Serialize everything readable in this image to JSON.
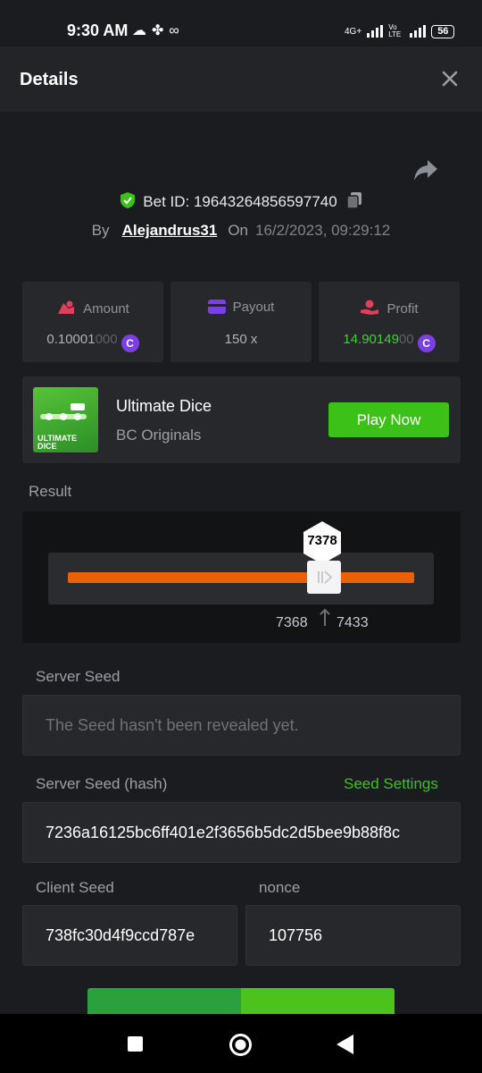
{
  "status_bar": {
    "time": "9:30 AM",
    "left_icons": [
      "cloud-icon",
      "fan-icon",
      "voicemail-icon"
    ],
    "network_label": "4G+",
    "volte_label": "Vo LTE",
    "battery": "56"
  },
  "header": {
    "title": "Details"
  },
  "bet": {
    "id_label": "Bet ID: 19643264856597740",
    "by_label": "By",
    "username": "Alejandrus31",
    "on_label": "On",
    "datetime": "16/2/2023, 09:29:12"
  },
  "stats": {
    "amount": {
      "label": "Amount",
      "value_main": "0.10001",
      "value_dim": "000",
      "coin": "C"
    },
    "payout": {
      "label": "Payout",
      "value": "150 x"
    },
    "profit": {
      "label": "Profit",
      "value_main": "14.90149",
      "value_dim": "00",
      "coin": "C"
    }
  },
  "game": {
    "name": "Ultimate Dice",
    "provider": "BC Originals",
    "thumb_text": "ULTIMATE DICE",
    "play_label": "Play Now"
  },
  "result": {
    "label": "Result",
    "value": "7378",
    "range_low": "7368",
    "range_high": "7433"
  },
  "server_seed": {
    "label": "Server Seed",
    "placeholder": "The Seed hasn't been revealed yet."
  },
  "server_seed_hash": {
    "label": "Server Seed (hash)",
    "settings_link": "Seed Settings",
    "value": "7236a16125bc6ff401e2f3656b5dc2d5bee9b88f8c"
  },
  "client_seed": {
    "label": "Client Seed",
    "value": "738fc30d4f9ccd787e"
  },
  "nonce": {
    "label": "nonce",
    "value": "107756"
  },
  "colors": {
    "accent_green": "#3bc117",
    "slider_orange": "#ec6107",
    "coin_purple": "#7b3fe4"
  }
}
